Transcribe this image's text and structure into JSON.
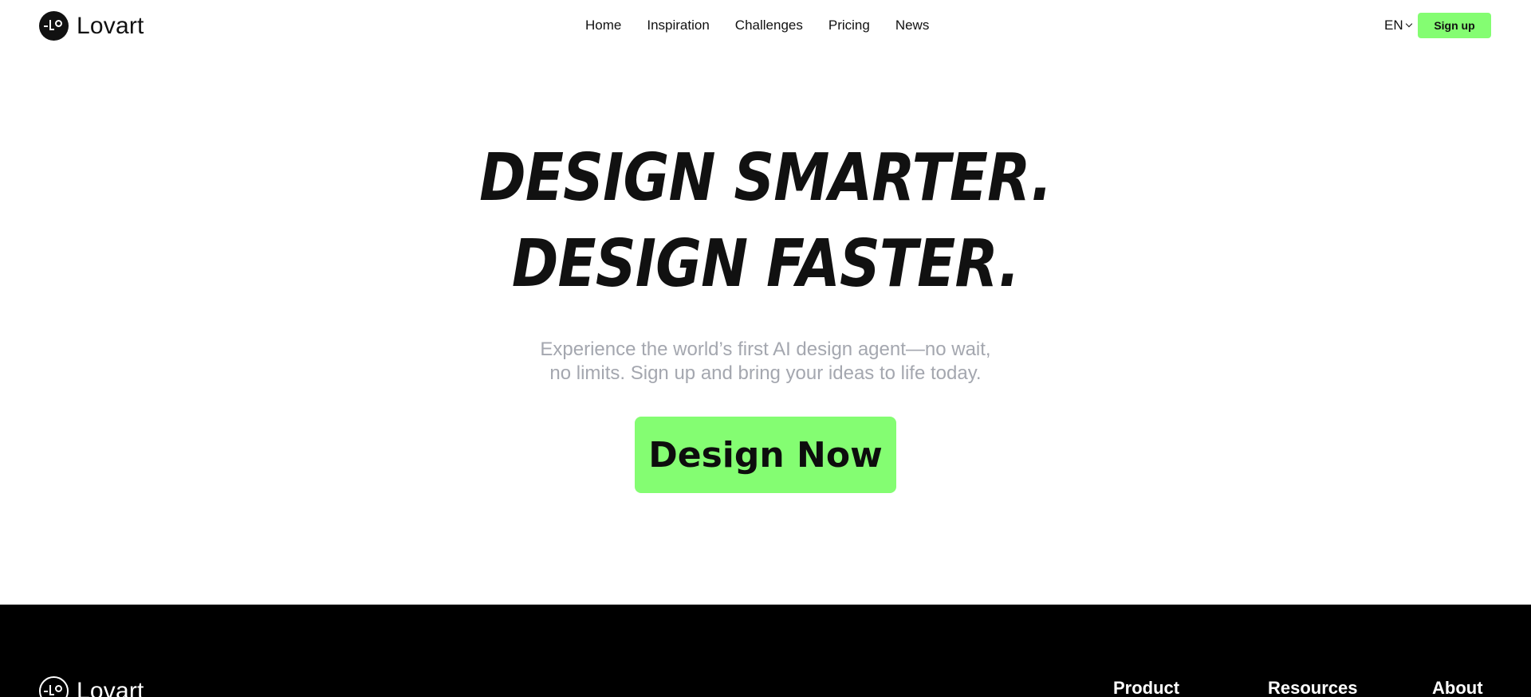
{
  "header": {
    "brand": "Lovart",
    "nav": [
      "Home",
      "Inspiration",
      "Challenges",
      "Pricing",
      "News"
    ],
    "language": "EN",
    "signup_label": "Sign up"
  },
  "hero": {
    "title_line1": "DESIGN SMARTER.",
    "title_line2": "DESIGN FASTER.",
    "subtitle_line1": "Experience the world’s first AI design agent—no wait,",
    "subtitle_line2": "no limits. Sign up and bring your ideas to life today.",
    "cta_label": "Design Now"
  },
  "footer": {
    "brand": "Lovart",
    "columns": [
      "Product",
      "Resources",
      "About"
    ]
  },
  "colors": {
    "accent": "#84fd72",
    "text": "#111111",
    "subtitle": "#a4a7af",
    "footer_bg": "#000000"
  },
  "icons": [
    "lovart-logo-icon",
    "chevron-down-icon"
  ]
}
